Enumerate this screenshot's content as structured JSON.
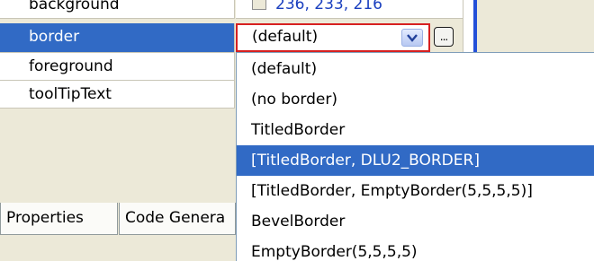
{
  "properties": {
    "rows": [
      {
        "name": "background",
        "value": "236, 233, 216"
      },
      {
        "name": "border",
        "value": "(default)"
      },
      {
        "name": "foreground",
        "value": ""
      },
      {
        "name": "toolTipText",
        "value": ""
      }
    ]
  },
  "editor": {
    "current_value": "(default)",
    "arrow_icon": "chevron-down",
    "ellipsis_label": "..."
  },
  "dropdown": {
    "options": [
      "(default)",
      "(no border)",
      "TitledBorder",
      "[TitledBorder, DLU2_BORDER]",
      "[TitledBorder, EmptyBorder(5,5,5,5)]",
      "BevelBorder",
      "EmptyBorder(5,5,5,5)"
    ],
    "selected_index": 3
  },
  "tabs": [
    "Properties",
    "Code Genera"
  ],
  "colors": {
    "selection": "#316ac5",
    "combo_border": "#d72020",
    "background": "#ece9d8"
  }
}
